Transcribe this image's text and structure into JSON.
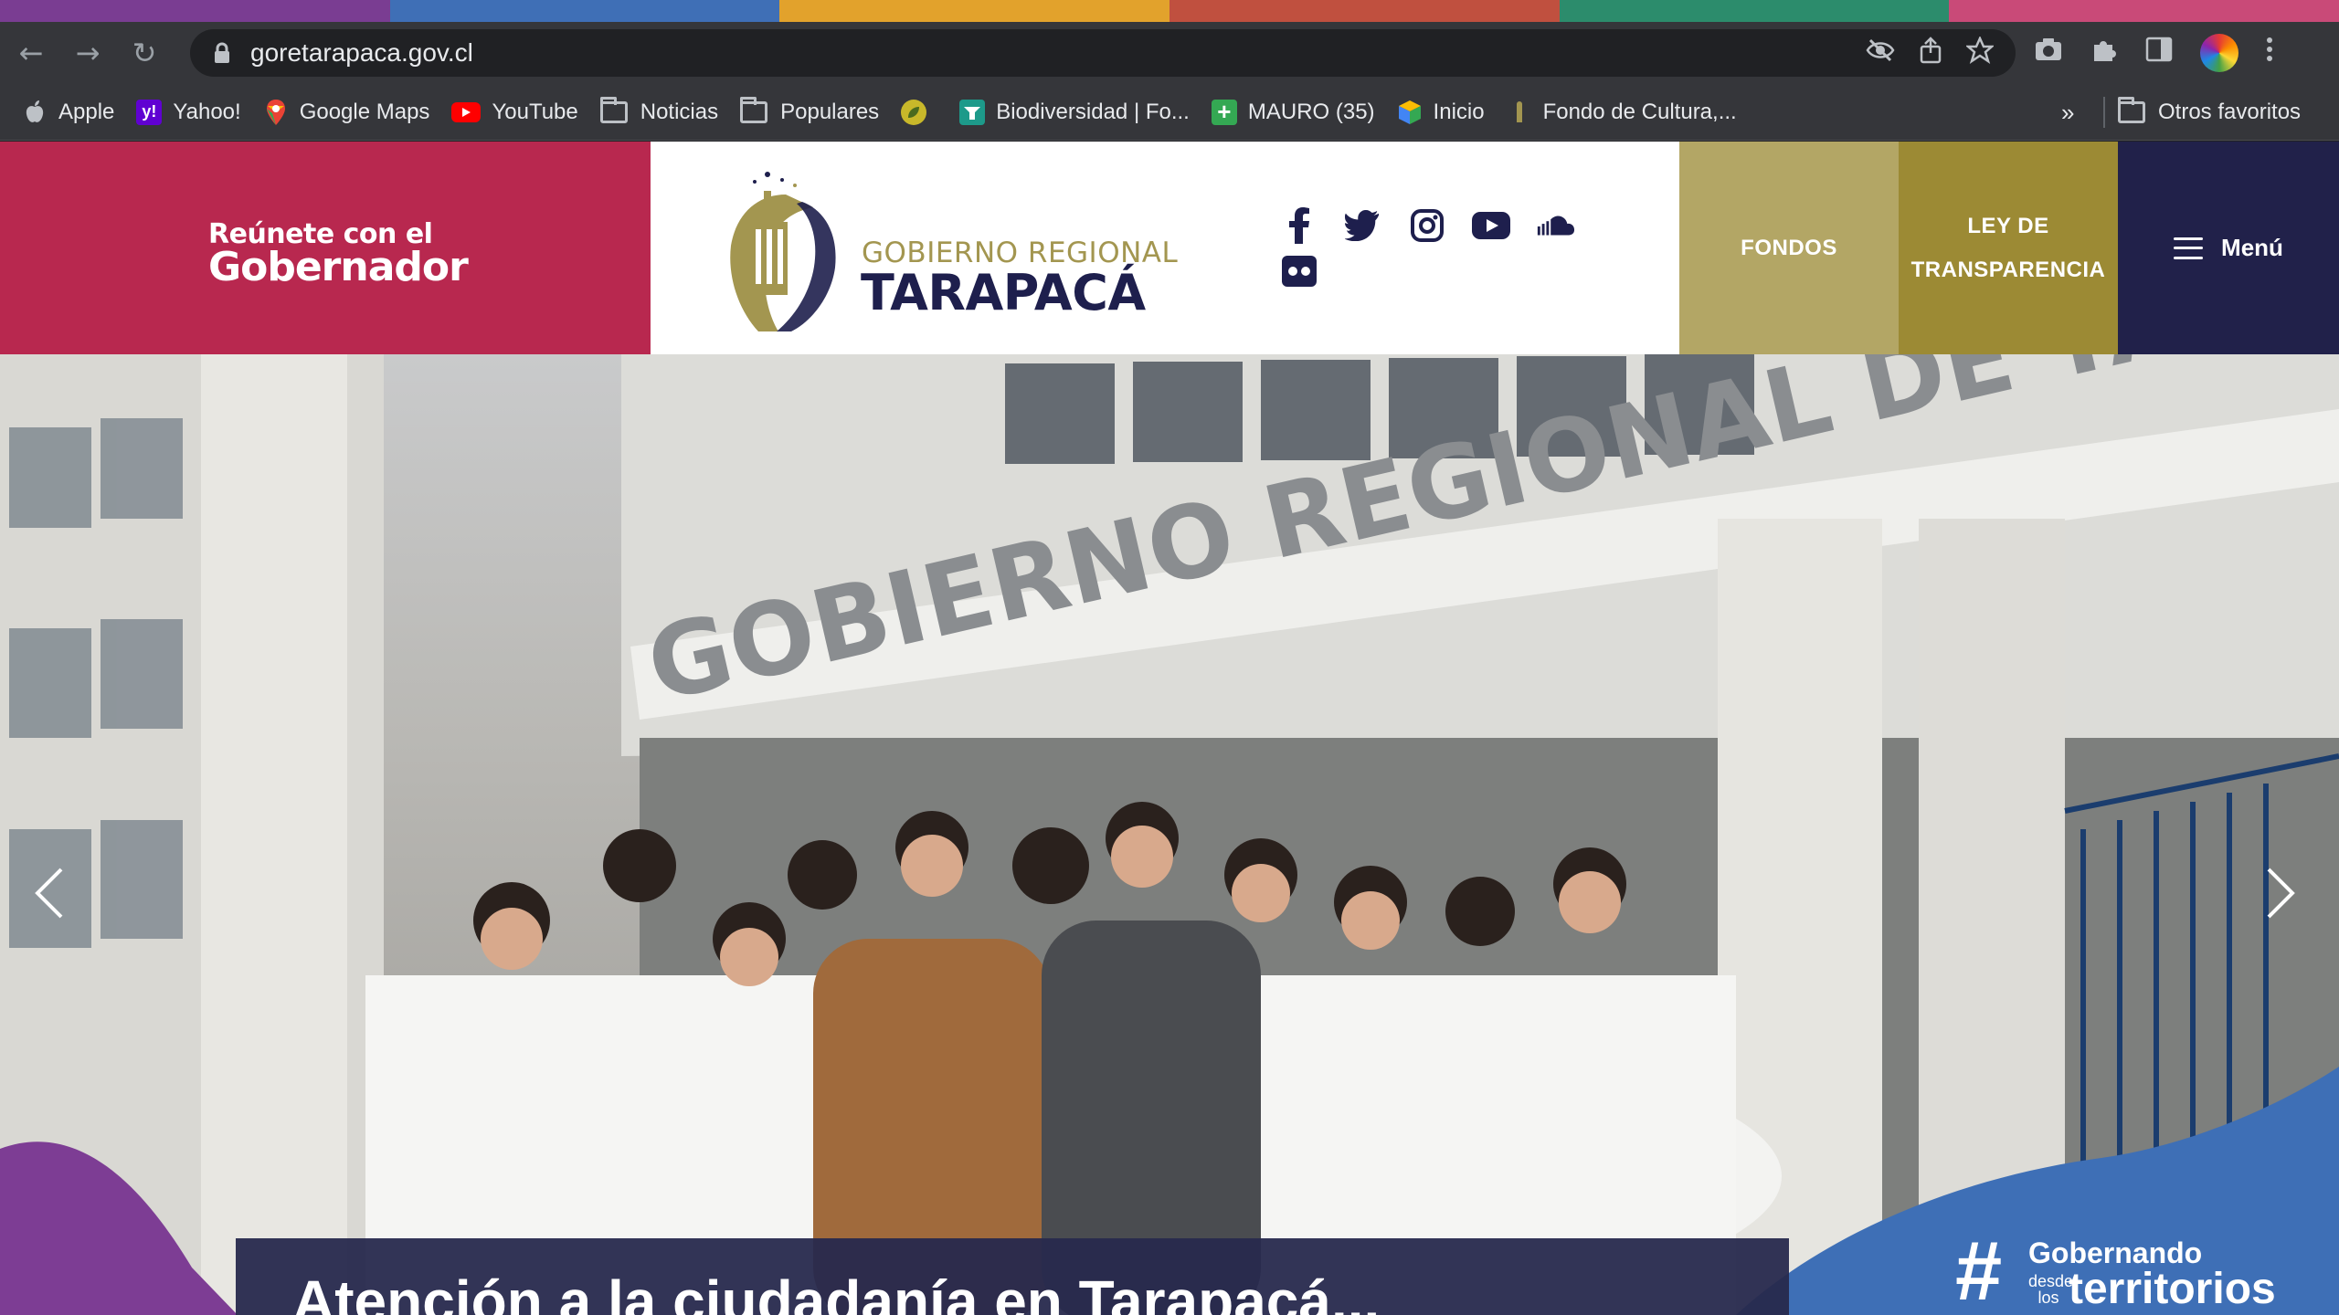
{
  "browser": {
    "url": "goretarapaca.gov.cl",
    "color_band": [
      "#7a3d92",
      "#3f6fb6",
      "#e2a22c",
      "#c0503f",
      "#2c8c6c",
      "#c94a78"
    ],
    "nav": {
      "back_icon": "back-arrow-icon",
      "forward_icon": "forward-arrow-icon",
      "reload_icon": "reload-icon"
    }
  },
  "bookmarks": {
    "items": [
      {
        "label": "Apple",
        "icon": "apple-icon"
      },
      {
        "label": "Yahoo!",
        "icon": "yahoo-icon"
      },
      {
        "label": "Google Maps",
        "icon": "google-maps-icon"
      },
      {
        "label": "YouTube",
        "icon": "youtube-icon"
      },
      {
        "label": "Noticias",
        "icon": "folder-icon"
      },
      {
        "label": "Populares",
        "icon": "folder-icon"
      },
      {
        "label": "",
        "icon": "leaf-icon"
      },
      {
        "label": "Biodiversidad | Fo...",
        "icon": "biodiversidad-icon"
      },
      {
        "label": "MAURO (35)",
        "icon": "plus-icon"
      },
      {
        "label": "Inicio",
        "icon": "cube-icon"
      },
      {
        "label": "Fondo de Cultura,...",
        "icon": "emblem-icon"
      }
    ],
    "more": "»",
    "other": "Otros favoritos"
  },
  "site": {
    "cta": {
      "line1": "Reúnete con el",
      "line2": "Gobernador"
    },
    "logo": {
      "small": "GOBIERNO REGIONAL",
      "big": "TARAPACÁ"
    },
    "socials": [
      "facebook-icon",
      "twitter-icon",
      "instagram-icon",
      "youtube-icon",
      "soundcloud-icon",
      "flickr-icon"
    ],
    "fondos": "FONDOS",
    "ley": {
      "line1": "LEY DE",
      "line2": "TRANSPARENCIA"
    },
    "menu": "Menú",
    "colors": {
      "cta": "#b8284f",
      "fondos": "#b3a665",
      "ley": "#9c8a34",
      "menu": "#21214a",
      "logo_navy": "#1e1f4d",
      "logo_gold": "#a39650"
    }
  },
  "hero": {
    "building_sign": "GOBIERNO REGIONAL DE TARAPACÁ",
    "caption": "Atención a la ciudadanía en Tarapacá...",
    "hashtag": {
      "hash": "#",
      "word1": "Gobernando",
      "word2": "desde los",
      "word3": "territorios"
    }
  }
}
